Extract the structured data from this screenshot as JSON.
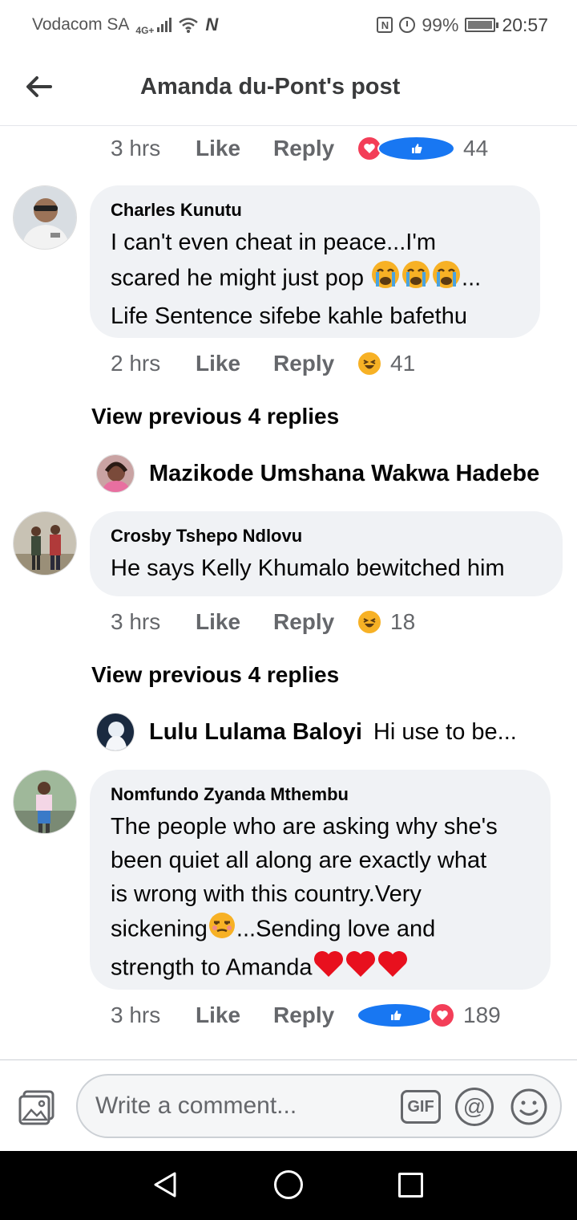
{
  "status_bar": {
    "carrier": "Vodacom SA",
    "network": "4G+",
    "battery_percent": "99%",
    "battery_level": 0.99,
    "time": "20:57"
  },
  "header": {
    "title": "Amanda du-Pont's post",
    "back_icon": "arrow-left-icon"
  },
  "comments": [
    {
      "time": "3 hrs",
      "like_label": "Like",
      "reply_label": "Reply",
      "reactions": [
        "love",
        "like"
      ],
      "reaction_count": "44"
    },
    {
      "author": "Charles Kunutu",
      "text_line1": "I can't even cheat in peace...I'm",
      "text_line2_a": "scared he might just pop ",
      "text_line2_b": "...",
      "text_line3": "Life Sentence sifebe kahle bafethu",
      "emojis": [
        "loudly-crying-face",
        "loudly-crying-face",
        "loudly-crying-face"
      ],
      "time": "2 hrs",
      "like_label": "Like",
      "reply_label": "Reply",
      "reactions": [
        "haha"
      ],
      "reaction_count": "41",
      "view_previous": "View previous 4 replies",
      "reply_preview_name": "Mazikode Umshana Wakwa Hadebe"
    },
    {
      "author": "Crosby Tshepo Ndlovu",
      "text": "He says Kelly Khumalo bewitched him",
      "time": "3 hrs",
      "like_label": "Like",
      "reply_label": "Reply",
      "reactions": [
        "haha"
      ],
      "reaction_count": "18",
      "view_previous": "View previous 4 replies",
      "reply_preview_name": "Lulu Lulama Baloyi",
      "reply_preview_snippet": "Hi use to be..."
    },
    {
      "author": "Nomfundo Zyanda Mthembu",
      "text_line1": "The people who are asking why she's",
      "text_line2": "been quiet all along are exactly what",
      "text_line3": "is wrong with this country.Very",
      "text_line4_a": "sickening",
      "text_line4_b": "...Sending love and",
      "text_line5": "strength to Amanda",
      "emojis": [
        "unamused-face",
        "red-heart",
        "red-heart",
        "red-heart"
      ],
      "time": "3 hrs",
      "like_label": "Like",
      "reply_label": "Reply",
      "reactions": [
        "like",
        "love"
      ],
      "reaction_count": "189"
    }
  ],
  "composer": {
    "placeholder": "Write a comment...",
    "gif_label": "GIF",
    "mention_label": "@",
    "photo_icon": "photo-icon",
    "emoji_icon": "smiley-icon"
  },
  "colors": {
    "bubble": "#f0f2f5",
    "meta": "#65676b",
    "like_blue": "#1877f2",
    "love_red": "#f33e58",
    "haha_yellow": "#f7b125"
  }
}
